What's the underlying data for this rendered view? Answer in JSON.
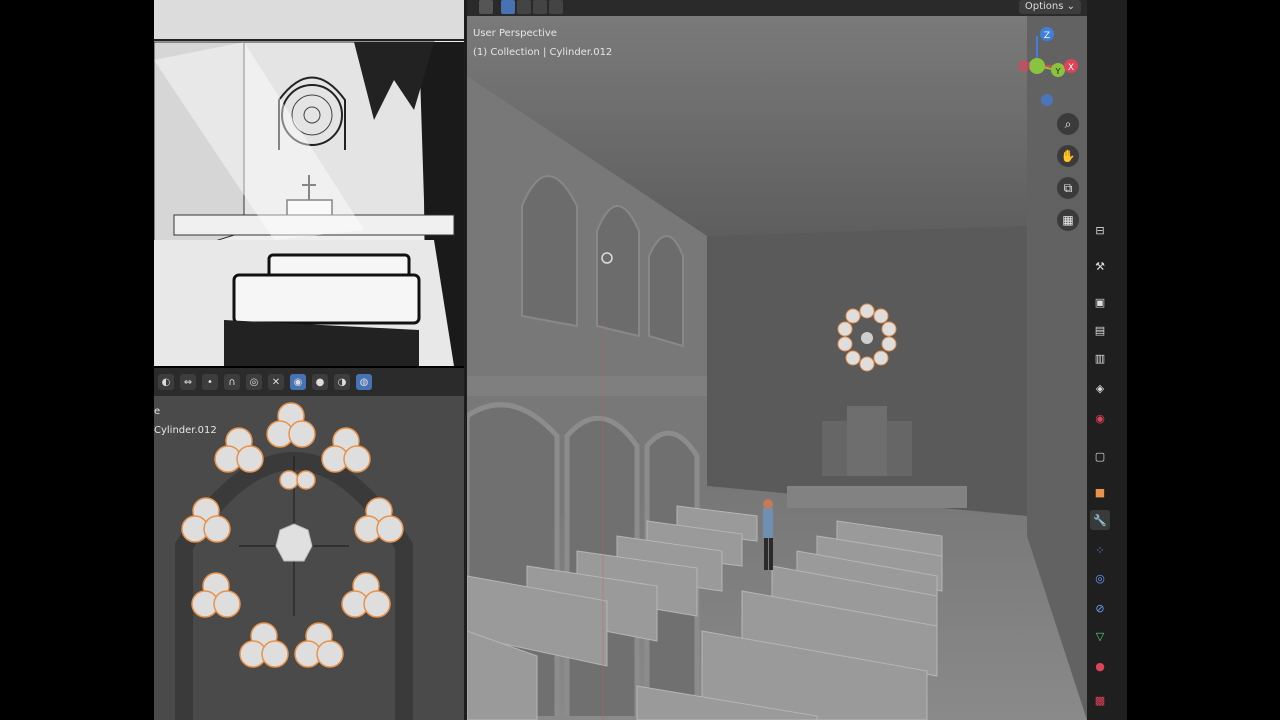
{
  "viewport": {
    "view_name": "User Perspective",
    "collection_line": "(1) Collection | Cylinder.012",
    "options_label": "Options"
  },
  "left_view": {
    "line1": "e",
    "line2": "Cylinder.012"
  },
  "gizmo": {
    "z": "Z",
    "y": "Y",
    "x": "X"
  },
  "colors": {
    "active_blue": "#4772b3",
    "panel_dark": "#2b2b2b",
    "viewport_gray": "#6a6a6a",
    "rose_orange": "#e8924a",
    "x_axis": "#e0425a",
    "y_axis": "#8ac43f",
    "z_axis": "#3f7fe0"
  },
  "icons": {
    "zoom": "magnifier-icon",
    "pan": "hand-icon",
    "camera": "camera-icon",
    "ortho": "grid-icon"
  }
}
